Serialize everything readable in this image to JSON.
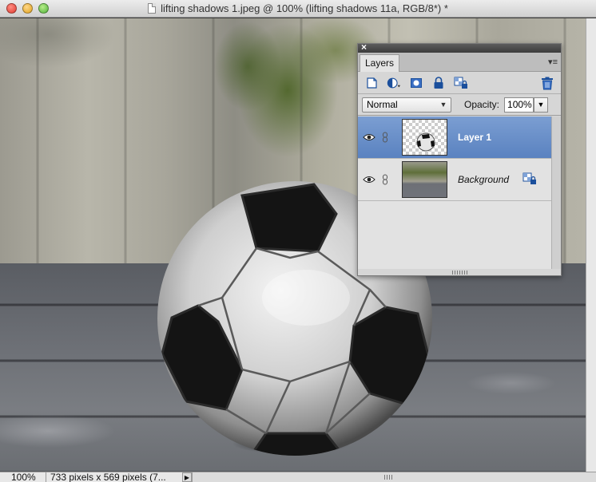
{
  "window": {
    "title": "lifting shadows 1.jpeg @ 100% (lifting shadows 11a, RGB/8*) *"
  },
  "layers_panel": {
    "close_glyph": "×",
    "tab_label": "Layers",
    "menu_glyph": "▾≡",
    "toolbar_icons": [
      "new-layer-icon",
      "adjustment-layer-icon",
      "layer-mask-icon",
      "lock-icon",
      "lock-transparency-icon",
      "trash-icon"
    ],
    "blend_mode": "Normal",
    "opacity_label": "Opacity:",
    "opacity_value": "100%",
    "layers": [
      {
        "name": "Layer 1",
        "selected": true,
        "visible": true
      },
      {
        "name": "Background",
        "selected": false,
        "visible": true,
        "locked": true
      }
    ]
  },
  "status_bar": {
    "zoom": "100%",
    "doc_info": "733 pixels x 569 pixels (7...",
    "arrow_glyph": "▶"
  },
  "colors": {
    "selected_layer": "#5a82c0",
    "panel_bg": "#d6d6d6"
  }
}
